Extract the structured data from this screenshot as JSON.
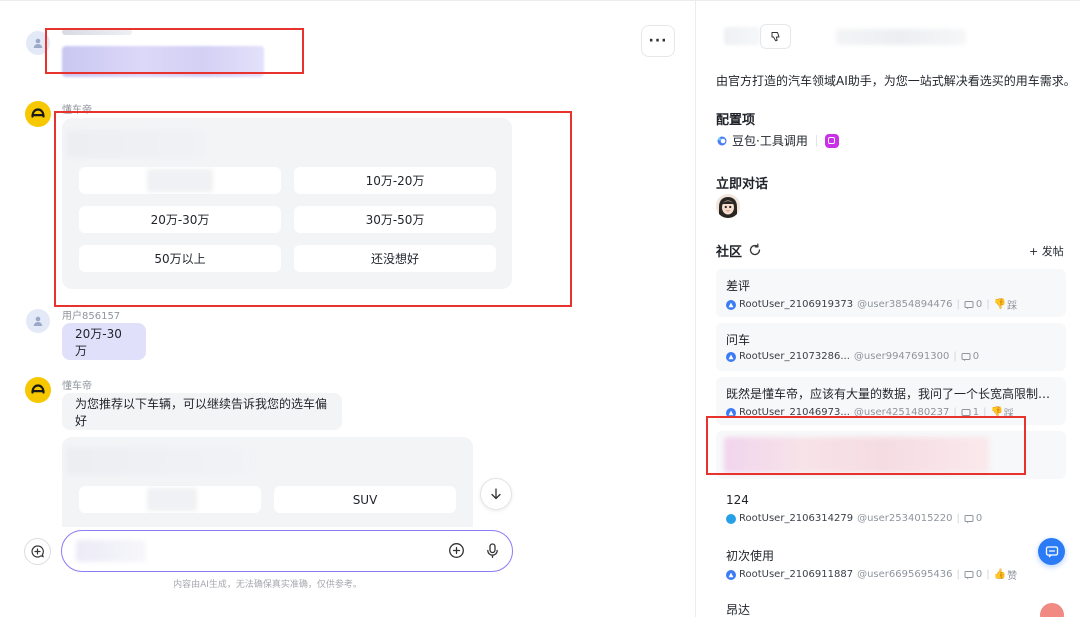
{
  "chat": {
    "bot_name": "懂车帝",
    "user_name": "用户856157",
    "budget_options": [
      "",
      "10万-20万",
      "20万-30万",
      "30万-50万",
      "50万以上",
      "还没想好"
    ],
    "user_reply": "20万-30万",
    "bot_reply": "为您推荐以下车辆，可以继续告诉我您的选车偏好",
    "type_options": [
      "",
      "SUV"
    ],
    "input_placeholder": "",
    "disclaimer": "内容由AI生成，无法确保真实准确，仅供参考。",
    "more_label": "···"
  },
  "side": {
    "description": "由官方打造的汽车领域AI助手，为您一站式解决看选买的用车需求。",
    "config_title": "配置项",
    "config_item": "豆包·工具调用",
    "talk_title": "立即对话",
    "community_title": "社区",
    "post_button": "+ 发帖",
    "posts": [
      {
        "title": "差评",
        "user": "RootUser_2106919373",
        "handle": "@user3854894476",
        "comments": "0",
        "extra": "踩"
      },
      {
        "title": "问车",
        "user": "RootUser_21073286...",
        "handle": "@user9947691300",
        "comments": "0",
        "extra": ""
      },
      {
        "title": "既然是懂车帝，应该有大量的数据，我问了一个长宽高限制在指...",
        "user": "RootUser_21046973...",
        "handle": "@user4251480237",
        "comments": "1",
        "extra": "踩"
      },
      {
        "title": "124",
        "user": "RootUser_2106314279",
        "handle": "@user2534015220",
        "comments": "0",
        "extra": ""
      },
      {
        "title": "初次使用",
        "user": "RootUser_2106911887",
        "handle": "@user6695695436",
        "comments": "0",
        "extra": "赞"
      },
      {
        "title": "昂达",
        "user": "",
        "handle": "",
        "comments": "",
        "extra": ""
      }
    ]
  },
  "colors": {
    "accent": "#7a6cf0",
    "bot_yellow": "#f7c800",
    "annotation_red": "#e8322d",
    "user_bubble": "#e1e0fb",
    "link_blue": "#2b7bf6"
  },
  "icons": [
    "user-avatar-icon",
    "bot-avatar-icon",
    "more-icon",
    "arrow-down-icon",
    "new-chat-icon",
    "plus-circle-icon",
    "mic-icon",
    "dislike-icon",
    "refresh-icon",
    "comment-icon",
    "thumb-down-icon",
    "thumb-up-icon",
    "chat-fab-icon",
    "doubao-icon"
  ]
}
